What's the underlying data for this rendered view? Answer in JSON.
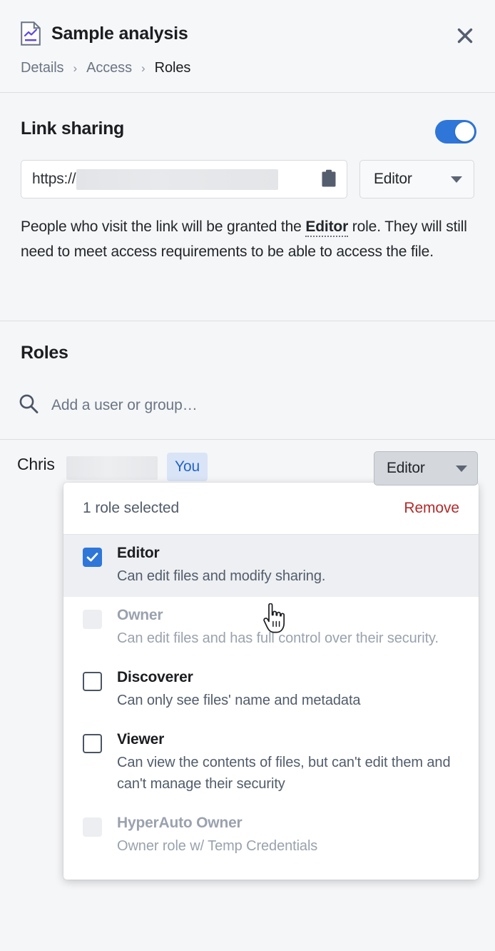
{
  "header": {
    "file_icon": "document-chart-icon",
    "title": "Sample analysis",
    "close_icon": "close-icon",
    "breadcrumb": [
      {
        "label": "Details",
        "current": false
      },
      {
        "label": "Access",
        "current": false
      },
      {
        "label": "Roles",
        "current": true
      }
    ],
    "breadcrumb_separator": "›"
  },
  "link_sharing": {
    "title": "Link sharing",
    "toggle_on": true,
    "toggle_color": "#2f76d9",
    "url_prefix": "https://",
    "url_redacted": true,
    "copy_icon": "clipboard-icon",
    "role_select_value": "Editor",
    "role_select_caret_icon": "chevron-down-icon",
    "description_prefix": "People who visit the link will be granted the ",
    "description_emphasis": "Editor",
    "description_suffix": " role. They will still need to meet access requirements to be able to access the file."
  },
  "roles": {
    "title": "Roles",
    "search_icon": "search-icon",
    "search_placeholder": "Add a user or group…",
    "user": {
      "name": "Chris",
      "name_redacted": true,
      "badge": "You",
      "badge_bg": "#d9e4f7",
      "badge_color": "#2464c4",
      "role_button_label": "Editor",
      "role_button_caret_icon": "chevron-down-icon"
    }
  },
  "dropdown": {
    "count_label": "1 role selected",
    "remove_label": "Remove",
    "remove_color": "#b52a2a",
    "checkbox_checked_color": "#2f76d9",
    "options": [
      {
        "name": "Editor",
        "description": "Can edit files and modify sharing.",
        "checked": true,
        "disabled": false,
        "highlighted": true
      },
      {
        "name": "Owner",
        "description": "Can edit files and has full control over their security.",
        "checked": false,
        "disabled": true,
        "highlighted": false
      },
      {
        "name": "Discoverer",
        "description": "Can only see files' name and metadata",
        "checked": false,
        "disabled": false,
        "highlighted": false
      },
      {
        "name": "Viewer",
        "description": "Can view the contents of files, but can't edit them and can't manage their security",
        "checked": false,
        "disabled": false,
        "highlighted": false
      },
      {
        "name": "HyperAuto Owner",
        "description": "Owner role w/ Temp Credentials",
        "checked": false,
        "disabled": true,
        "highlighted": false
      }
    ]
  },
  "cursor": {
    "icon": "pointing-hand-cursor"
  }
}
